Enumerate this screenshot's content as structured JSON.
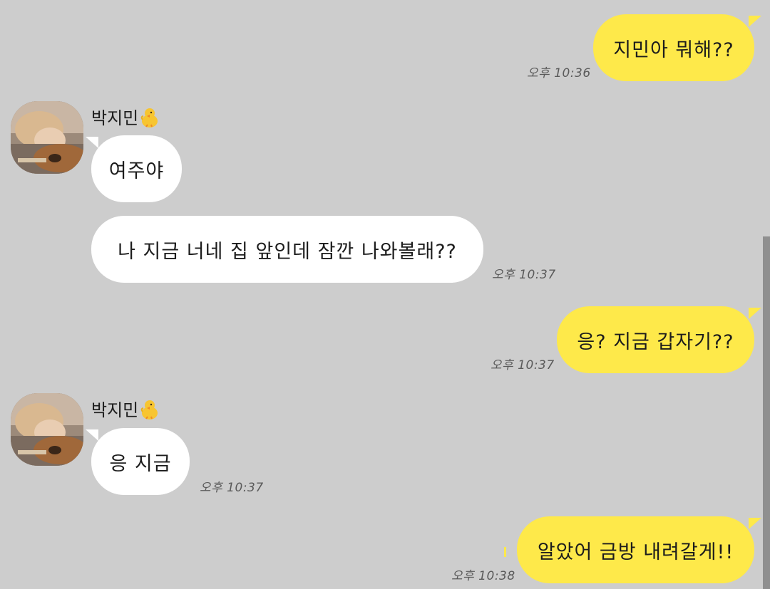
{
  "chat": {
    "sender_name": "박지민",
    "sender_emoji": "baby-chick-icon",
    "messages": [
      {
        "from": "me",
        "text": "지민아 뭐해??",
        "time": "오후 10:36"
      },
      {
        "from": "them",
        "text": "여주야",
        "time": ""
      },
      {
        "from": "them",
        "text": "나 지금 너네 집 앞인데 잠깐 나와볼래??",
        "time": "오후 10:37"
      },
      {
        "from": "me",
        "text": "응? 지금 갑자기??",
        "time": "오후 10:37"
      },
      {
        "from": "them",
        "text": "응 지금",
        "time": "오후 10:37"
      },
      {
        "from": "me",
        "text": "알았어 금방 내려갈게!!",
        "time": "오후 10:38"
      }
    ]
  },
  "colors": {
    "background": "#cdcdcd",
    "my_bubble": "#fee94a",
    "their_bubble": "#ffffff",
    "time_text": "#5a5a5a"
  }
}
